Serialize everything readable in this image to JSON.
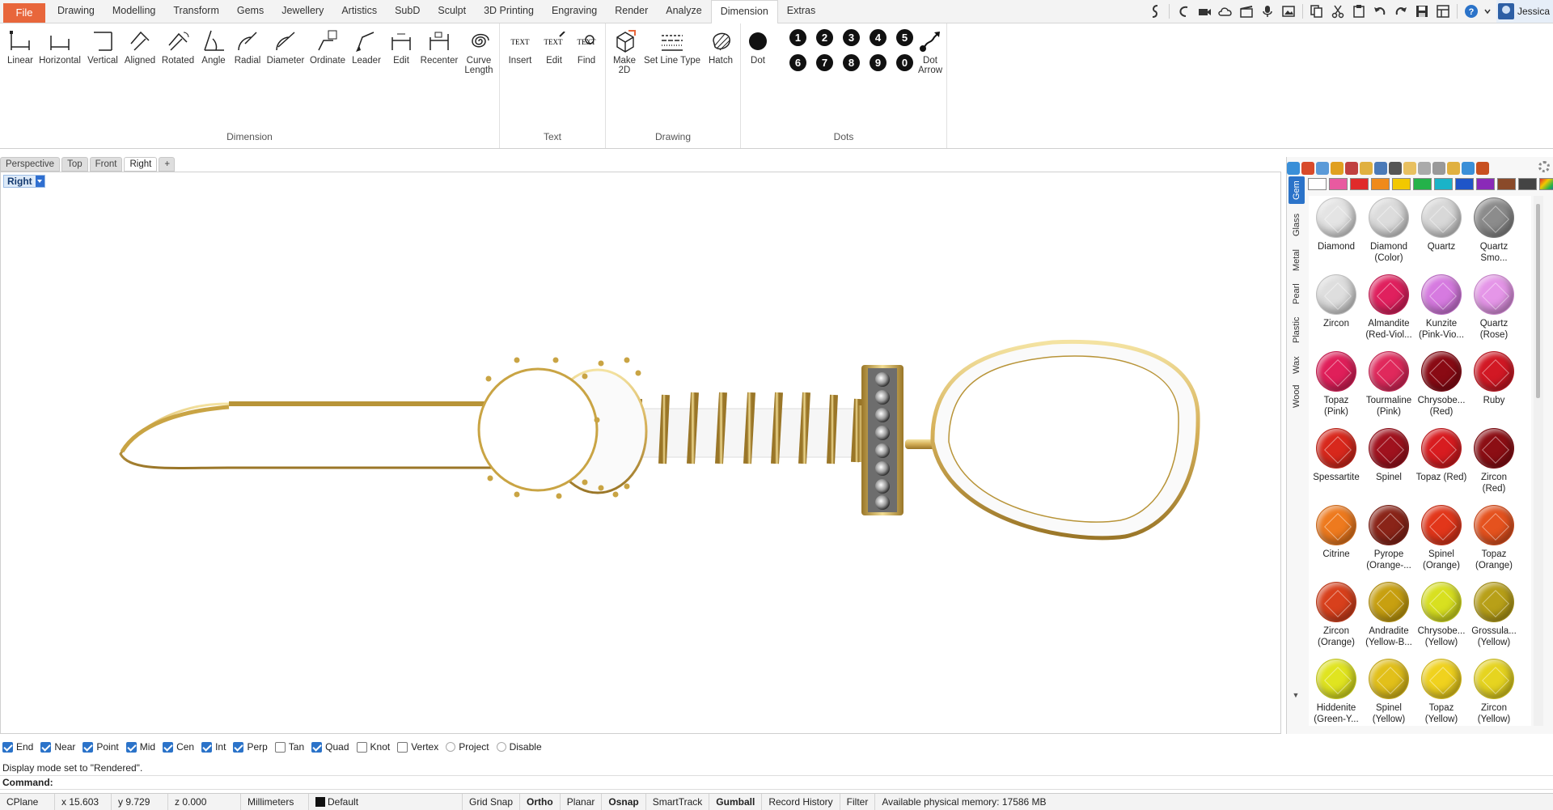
{
  "menubar": {
    "file_label": "File",
    "tabs": [
      "Drawing",
      "Modelling",
      "Transform",
      "Gems",
      "Jewellery",
      "Artistics",
      "SubD",
      "Sculpt",
      "3D Printing",
      "Engraving",
      "Render",
      "Analyze",
      "Dimension",
      "Extras"
    ],
    "active_tab": "Dimension",
    "user_name": "Jessica"
  },
  "ribbon": {
    "groups": [
      {
        "title": "Dimension",
        "tools": [
          "Linear",
          "Horizontal",
          "Vertical",
          "Aligned",
          "Rotated",
          "Angle",
          "Radial",
          "Diameter",
          "Ordinate",
          "Leader",
          "Edit",
          "Recenter",
          "Curve\nLength"
        ]
      },
      {
        "title": "Text",
        "tools": [
          "Insert",
          "Edit",
          "Find"
        ]
      },
      {
        "title": "Drawing",
        "tools": [
          "Make\n2D",
          "Set Line Type",
          "Hatch"
        ]
      },
      {
        "title": "Dots",
        "tools": [
          "Dot",
          "Dot\nArrow"
        ],
        "numbers_top": [
          "1",
          "2",
          "3",
          "4",
          "5"
        ],
        "numbers_bottom": [
          "6",
          "7",
          "8",
          "9",
          "0"
        ]
      }
    ],
    "text_icon_label": "TEXT"
  },
  "viewport": {
    "tabs": [
      "Perspective",
      "Top",
      "Front",
      "Right"
    ],
    "active_tab": "Right",
    "add_tab_symbol": "+",
    "label": "Right"
  },
  "material_panel": {
    "tabs": [
      "Gem",
      "Glass",
      "Metal",
      "Pearl",
      "Plastic",
      "Wax",
      "Wood"
    ],
    "active_tab": "Gem",
    "swatch_colors": [
      "#ffffff",
      "#e85aa0",
      "#e02a2a",
      "#f08a1a",
      "#f2c800",
      "#24b24a",
      "#1ab3c8",
      "#1f55c8",
      "#8a2ab8",
      "#8a4a2a",
      "#444444"
    ],
    "gems": [
      {
        "name": "Diamond",
        "color": "#e4e4e4"
      },
      {
        "name": "Diamond\n(Color)",
        "color": "#dcdcdc"
      },
      {
        "name": "Quartz",
        "color": "#d8d8d8"
      },
      {
        "name": "Quartz\nSmo...",
        "color": "#8c8c8c"
      },
      {
        "name": "Zircon",
        "color": "#dedede"
      },
      {
        "name": "Almandite\n(Red-Viol...",
        "color": "#e0205e"
      },
      {
        "name": "Kunzite\n(Pink-Vio...",
        "color": "#d67ae0"
      },
      {
        "name": "Quartz\n(Rose)",
        "color": "#e596e8"
      },
      {
        "name": "Topaz\n(Pink)",
        "color": "#e01f5a"
      },
      {
        "name": "Tourmaline\n(Pink)",
        "color": "#e0295c"
      },
      {
        "name": "Chrysobe...\n(Red)",
        "color": "#8a0a14"
      },
      {
        "name": "Ruby",
        "color": "#d21824"
      },
      {
        "name": "Spessartite",
        "color": "#d8281c"
      },
      {
        "name": "Spinel",
        "color": "#a0121e"
      },
      {
        "name": "Topaz (Red)",
        "color": "#d81c20"
      },
      {
        "name": "Zircon\n(Red)",
        "color": "#8c0e14"
      },
      {
        "name": "Citrine",
        "color": "#ee7a1e"
      },
      {
        "name": "Pyrope\n(Orange-...",
        "color": "#8a2418"
      },
      {
        "name": "Spinel\n(Orange)",
        "color": "#e2361a"
      },
      {
        "name": "Topaz\n(Orange)",
        "color": "#e5521e"
      },
      {
        "name": "Zircon\n(Orange)",
        "color": "#d8401c"
      },
      {
        "name": "Andradite\n(Yellow-B...",
        "color": "#c8a010"
      },
      {
        "name": "Chrysobe...\n(Yellow)",
        "color": "#d8e020"
      },
      {
        "name": "Grossula...\n(Yellow)",
        "color": "#b8a018"
      },
      {
        "name": "Hiddenite\n(Green-Y...",
        "color": "#e0e420"
      },
      {
        "name": "Spinel\n(Yellow)",
        "color": "#e2c01a"
      },
      {
        "name": "Topaz\n(Yellow)",
        "color": "#f0d21e"
      },
      {
        "name": "Zircon\n(Yellow)",
        "color": "#e6d420"
      }
    ]
  },
  "osnap": {
    "items": [
      {
        "label": "End",
        "checked": true
      },
      {
        "label": "Near",
        "checked": true
      },
      {
        "label": "Point",
        "checked": true
      },
      {
        "label": "Mid",
        "checked": true
      },
      {
        "label": "Cen",
        "checked": true
      },
      {
        "label": "Int",
        "checked": true
      },
      {
        "label": "Perp",
        "checked": true
      },
      {
        "label": "Tan",
        "checked": false
      },
      {
        "label": "Quad",
        "checked": true
      },
      {
        "label": "Knot",
        "checked": false
      },
      {
        "label": "Vertex",
        "checked": false
      }
    ],
    "project_label": "Project",
    "disable_label": "Disable"
  },
  "command": {
    "history": "Display mode set to \"Rendered\".",
    "prompt": "Command:",
    "value": ""
  },
  "statusbar": {
    "cplane": "CPlane",
    "x": "x 15.603",
    "y": "y 9.729",
    "z": "z 0.000",
    "units": "Millimeters",
    "layer": "Default",
    "grid_snap": "Grid Snap",
    "ortho": "Ortho",
    "planar": "Planar",
    "osnap": "Osnap",
    "smarttrack": "SmartTrack",
    "gumball": "Gumball",
    "record_history": "Record History",
    "filter": "Filter",
    "memory": "Available physical memory: 17586 MB"
  },
  "colors": {
    "accent": "#2b73c9",
    "file_button": "#e8663b",
    "gold": "#c9a444"
  }
}
